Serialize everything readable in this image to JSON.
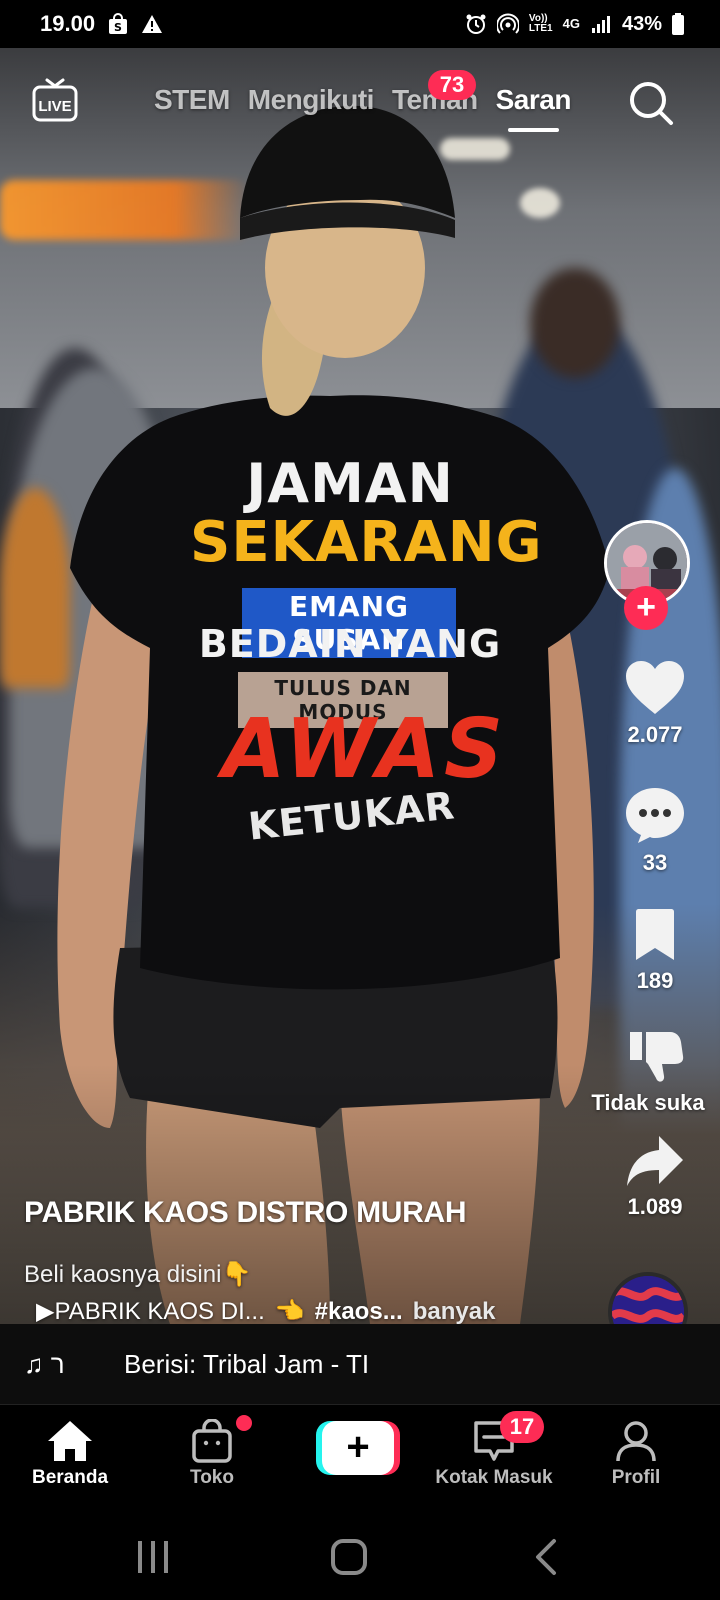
{
  "status_bar": {
    "time": "19.00",
    "network_label_top": "Vo))",
    "network_label_bottom": "LTE1",
    "network_type": "4G",
    "battery": "43%"
  },
  "top_nav": {
    "tabs": [
      {
        "label": "STEM",
        "active": false
      },
      {
        "label": "Mengikuti",
        "active": false
      },
      {
        "label": "Teman",
        "active": false
      },
      {
        "label": "Saran",
        "active": true
      }
    ],
    "friends_badge": "73",
    "live_label": "LIVE"
  },
  "video": {
    "shirt_lines": [
      "JAMAN",
      "SEKARANG",
      "EMANG SUSAH",
      "BEDAIN YANG",
      "TULUS DAN MODUS",
      "AWAS",
      "KETUKAR"
    ]
  },
  "rail": {
    "likes": "2.077",
    "comments": "33",
    "saves": "189",
    "dislike_label": "Tidak suka",
    "shares": "1.089"
  },
  "caption": {
    "author": "PABRIK KAOS DISTRO MURAH",
    "description": "Beli kaosnya disini👇",
    "link_text": "▶PABRIK KAOS DI...",
    "pointer_emoji": "👈",
    "hashtag": "#kaos...",
    "more": "banyak"
  },
  "music": {
    "note_icon": "♫",
    "prefix": "ר",
    "song": "Berisi: Tribal Jam - TI"
  },
  "bottom_nav": {
    "home": "Beranda",
    "shop": "Toko",
    "inbox": "Kotak Masuk",
    "inbox_badge": "17",
    "profile": "Profil",
    "create_symbol": "+"
  },
  "colors": {
    "accent": "#fe2c55",
    "cyan": "#25f4ee",
    "shirt_yellow": "#f5b31b",
    "shirt_red": "#e8321f",
    "shirt_blue": "#1f58c7"
  }
}
